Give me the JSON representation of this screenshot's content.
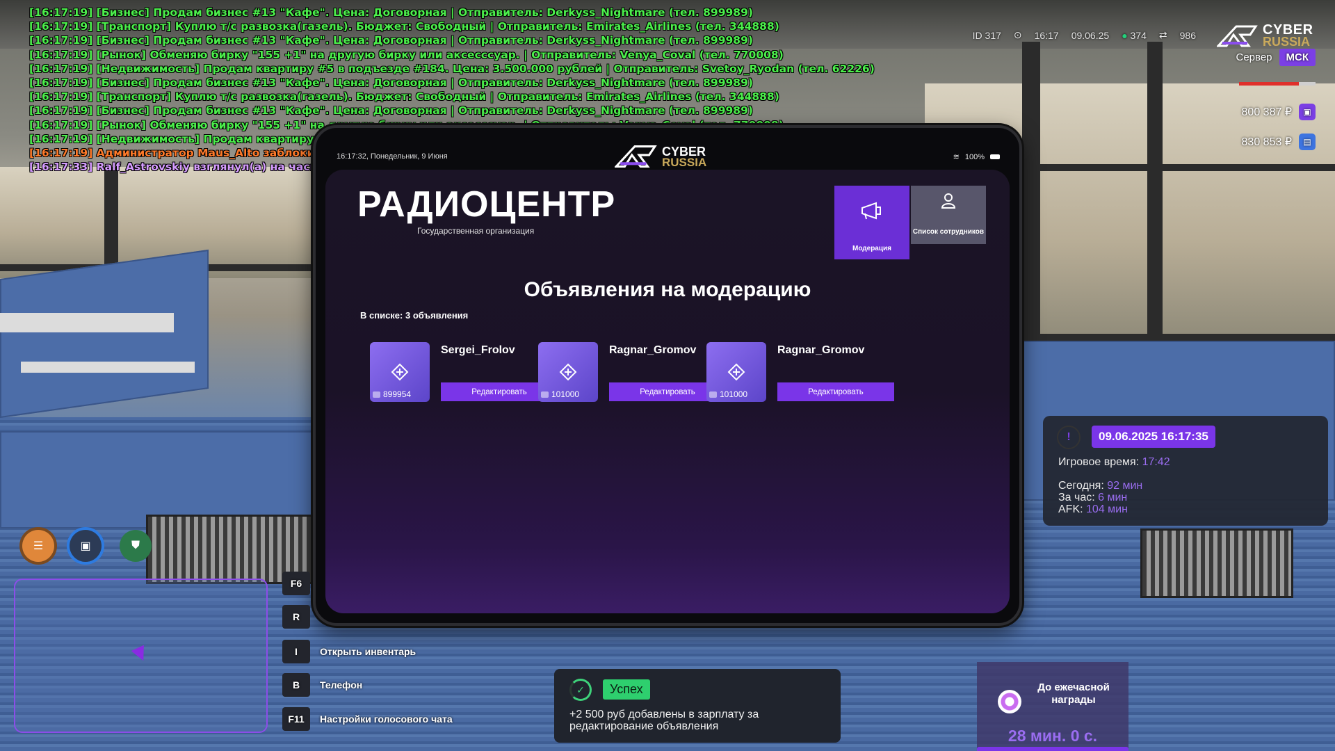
{
  "chat": {
    "lines": [
      {
        "text": "[16:17:19] [Бизнес] Продам бизнес #13 \"Кафе\". Цена: Договорная | Отправитель: Derkyss_Nightmare (тел. 899989)",
        "color": "#4cf04c"
      },
      {
        "text": "[16:17:19] [Транспорт] Куплю т/с развозка(газель). Бюджет: Свободный | Отправитель: Emirates_Airlines (тел. 344888)",
        "color": "#4cf04c"
      },
      {
        "text": "[16:17:19] [Бизнес] Продам бизнес #13 \"Кафе\". Цена: Договорная | Отправитель: Derkyss_Nightmare (тел. 899989)",
        "color": "#4cf04c"
      },
      {
        "text": "[16:17:19] [Рынок] Обменяю бирку \"155 +1\" на другую бирку или аксесссуар. | Отправитель: Venya_Coval (тел. 770008)",
        "color": "#4cf04c"
      },
      {
        "text": "[16:17:19] [Недвижимость] Продам квартиру #5 в подъезде #184. Цена: 3.500.000 рублей | Отправитель: Svetoy_Ryodan (тел. 62226)",
        "color": "#4cf04c"
      },
      {
        "text": "[16:17:19] [Бизнес] Продам бизнес #13 \"Кафе\". Цена: Договорная | Отправитель: Derkyss_Nightmare (тел. 899989)",
        "color": "#4cf04c"
      },
      {
        "text": "[16:17:19] [Транспорт] Куплю т/с развозка(газель). Бюджет: Свободный | Отправитель: Emirates_Airlines (тел. 344888)",
        "color": "#4cf04c"
      },
      {
        "text": "[16:17:19] [Бизнес] Продам бизнес #13 \"Кафе\". Цена: Договорная | Отправитель: Derkyss_Nightmare (тел. 899989)",
        "color": "#4cf04c"
      },
      {
        "text": "[16:17:19] [Рынок] Обменяю бирку \"155 +1\" на другую бирку или аксесссуар. | Отправитель: Venya_Coval (тел. 770008)",
        "color": "#4cf04c"
      },
      {
        "text": "[16:17:19] [Недвижимость] Продам квартиру #5 в",
        "color": "#4cf04c"
      },
      {
        "text": "[16:17:19] Администратор Maus_Alto заблокиров",
        "color": "#ff7a2a"
      },
      {
        "text": "[16:17:33] Ralf_Astrovskiy взглянул(а) на часы",
        "color": "#d69cff"
      }
    ]
  },
  "hud": {
    "id": "ID 317",
    "time": "16:17",
    "date": "09.06.25",
    "online": "374",
    "ping": "986",
    "logo_cyber": "CYBER",
    "logo_russia": "RUSSIA",
    "server_label": "Сервер",
    "server_name": "МСК",
    "health_fraction": 0.78,
    "cash": "800 387 ₽",
    "bank": "830 853 ₽"
  },
  "tablet": {
    "status_time": "16:17:32, Понедельник, 9 Июня",
    "wifi": "100%",
    "logo_cyber": "CYBER",
    "logo_russia": "RUSSIA",
    "org_title": "РАДИОЦЕНТР",
    "org_subtitle": "Государственная организация",
    "tiles": {
      "moderation": "Модерация",
      "staff": "Список сотрудников"
    },
    "section_title": "Объявления на модерацию",
    "list_count": "В списке: 3 объявления",
    "edit_label": "Редактировать",
    "ads": [
      {
        "name": "Sergei_Frolov",
        "number": "899954"
      },
      {
        "name": "Ragnar_Gromov",
        "number": "101000"
      },
      {
        "name": "Ragnar_Gromov",
        "number": "101000"
      }
    ]
  },
  "keys": [
    {
      "key": "F6",
      "label": ""
    },
    {
      "key": "R",
      "label": ""
    },
    {
      "key": "I",
      "label": "Открыть инвентарь"
    },
    {
      "key": "B",
      "label": "Телефон"
    },
    {
      "key": "F11",
      "label": "Настройки голосового чата"
    }
  ],
  "notification": {
    "tag": "Успех",
    "message": "+2 500 руб добавлены в зарплату за редактирование объявления"
  },
  "info_panel": {
    "datetime": "09.06.2025 16:17:35",
    "game_time_label": "Игровое время:",
    "game_time": "17:42",
    "today_label": "Сегодня:",
    "today": "92 мин",
    "hour_label": "За час:",
    "hour": "6 мин",
    "afk_label": "AFK:",
    "afk": "104 мин"
  },
  "reward": {
    "title": "До ежечасной награды",
    "countdown": "28 мин. 0 с."
  },
  "colors": {
    "accent": "#7a35e8",
    "chat_green": "#4cf04c",
    "success": "#2ecf6e"
  }
}
